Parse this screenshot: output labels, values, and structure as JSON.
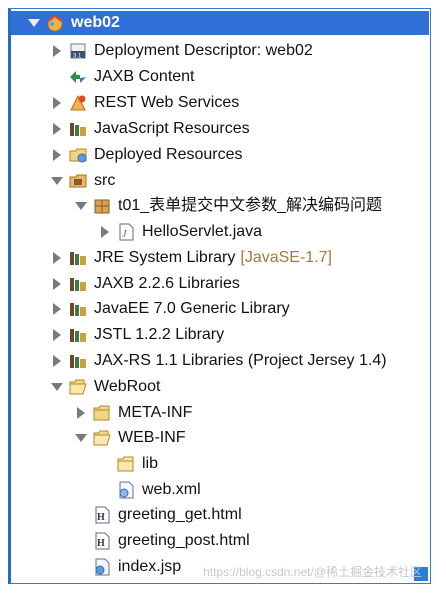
{
  "tree": {
    "root": {
      "label": "web02",
      "icon": "web-project-icon"
    },
    "items": [
      {
        "label": "Deployment Descriptor: web02",
        "icon": "deployment-descriptor-icon",
        "expander": "collapsed"
      },
      {
        "label": "JAXB Content",
        "icon": "jaxb-icon",
        "expander": "none"
      },
      {
        "label": "REST Web Services",
        "icon": "rest-services-icon",
        "expander": "collapsed"
      },
      {
        "label": "JavaScript Resources",
        "icon": "library-icon",
        "expander": "collapsed"
      },
      {
        "label": "Deployed Resources",
        "icon": "deployed-folder-icon",
        "expander": "collapsed"
      },
      {
        "label": "src",
        "icon": "source-folder-icon",
        "expander": "expanded"
      },
      {
        "label": "t01_表单提交中文参数_解决编码问题",
        "icon": "package-icon",
        "expander": "expanded"
      },
      {
        "label": "HelloServlet.java",
        "icon": "java-file-icon",
        "expander": "collapsed"
      },
      {
        "label": "JRE System Library",
        "suffix": "[JavaSE-1.7]",
        "icon": "library-icon",
        "expander": "collapsed"
      },
      {
        "label": "JAXB 2.2.6 Libraries",
        "icon": "library-icon",
        "expander": "collapsed"
      },
      {
        "label": "JavaEE 7.0 Generic Library",
        "icon": "library-icon",
        "expander": "collapsed"
      },
      {
        "label": "JSTL 1.2.2 Library",
        "icon": "library-icon",
        "expander": "collapsed"
      },
      {
        "label": "JAX-RS 1.1 Libraries (Project Jersey 1.4)",
        "icon": "library-icon",
        "expander": "collapsed"
      },
      {
        "label": "WebRoot",
        "icon": "folder-open-icon",
        "expander": "expanded"
      },
      {
        "label": "META-INF",
        "icon": "folder-icon",
        "expander": "collapsed"
      },
      {
        "label": "WEB-INF",
        "icon": "folder-open-icon",
        "expander": "expanded"
      },
      {
        "label": "lib",
        "icon": "folder-icon",
        "expander": "none"
      },
      {
        "label": "web.xml",
        "icon": "xml-file-icon",
        "expander": "none"
      },
      {
        "label": "greeting_get.html",
        "icon": "html-file-icon",
        "expander": "none"
      },
      {
        "label": "greeting_post.html",
        "icon": "html-file-icon",
        "expander": "none"
      },
      {
        "label": "index.jsp",
        "icon": "jsp-file-icon",
        "expander": "none"
      }
    ]
  },
  "watermark": "https://blog.csdn.net/@稀土掘金技术社区",
  "colors": {
    "selection": "#2f6fd6",
    "frame_border": "#2a7fd4",
    "library_suffix": "#a07b3a"
  }
}
